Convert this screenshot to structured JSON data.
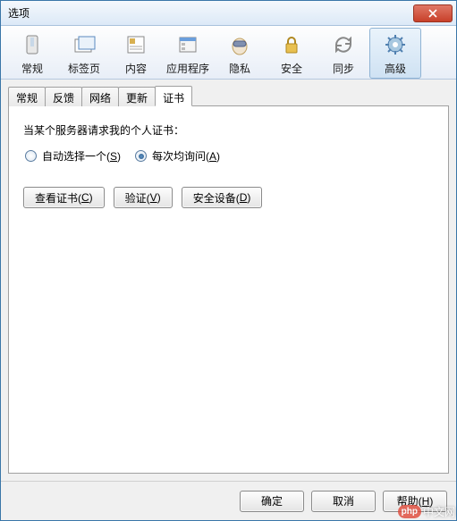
{
  "window": {
    "title": "选项"
  },
  "toolbar": {
    "items": [
      {
        "label": "常规"
      },
      {
        "label": "标签页"
      },
      {
        "label": "内容"
      },
      {
        "label": "应用程序"
      },
      {
        "label": "隐私"
      },
      {
        "label": "安全"
      },
      {
        "label": "同步"
      },
      {
        "label": "高级"
      }
    ],
    "activeIndex": 7
  },
  "tabs": {
    "items": [
      {
        "label": "常规"
      },
      {
        "label": "反馈"
      },
      {
        "label": "网络"
      },
      {
        "label": "更新"
      },
      {
        "label": "证书"
      }
    ],
    "activeIndex": 4
  },
  "panel": {
    "section_label": "当某个服务器请求我的个人证书：",
    "radios": {
      "auto_text": "自动选择一个(",
      "auto_key": "S",
      "auto_close": ")",
      "ask_text": "每次均询问(",
      "ask_key": "A",
      "ask_close": ")",
      "selected": "ask"
    },
    "buttons": {
      "view_text": "查看证书(",
      "view_key": "C",
      "view_close": ")",
      "verify_text": "验证(",
      "verify_key": "V",
      "verify_close": ")",
      "device_text": "安全设备(",
      "device_key": "D",
      "device_close": ")"
    }
  },
  "footer": {
    "ok": "确定",
    "cancel": "取消",
    "help_text": "帮助(",
    "help_key": "H",
    "help_close": ")"
  },
  "watermark": {
    "badge": "php",
    "text": "中文网"
  }
}
